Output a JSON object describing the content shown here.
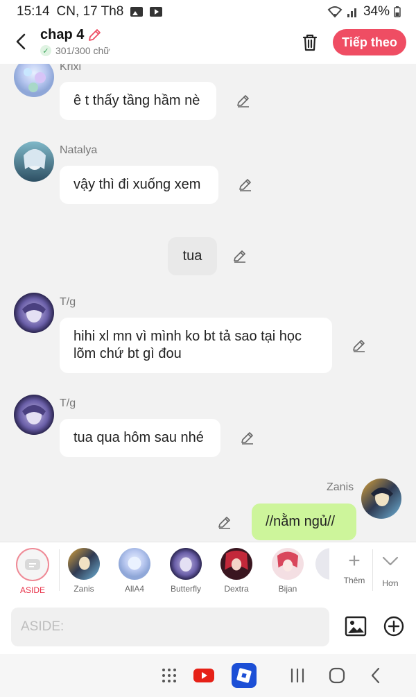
{
  "status_bar": {
    "time": "15:14",
    "date": "CN, 17 Th8",
    "battery": "34%"
  },
  "header": {
    "title": "chap 4",
    "word_count": "301/300 chữ",
    "next_label": "Tiếp theo"
  },
  "messages": [
    {
      "speaker": "Krixi",
      "text": "ê t thấy tầng hầm nè"
    },
    {
      "speaker": "Natalya",
      "text": "vậy thì đi xuống xem"
    },
    {
      "speaker": "",
      "text": "tua"
    },
    {
      "speaker": "T/g",
      "text_line1": "hihi xl mn vì mình ko bt tả sao tại học",
      "text_line2": "lõm chứ bt gì đou"
    },
    {
      "speaker": "T/g",
      "text": "tua qua hôm sau nhé"
    },
    {
      "speaker": "Zanis",
      "text": "//nằm ngủ//"
    }
  ],
  "characters": [
    {
      "label": "ASIDE"
    },
    {
      "label": "Zanis"
    },
    {
      "label": "AllA4"
    },
    {
      "label": "Butterfly"
    },
    {
      "label": "Dextra"
    },
    {
      "label": "Bijan"
    }
  ],
  "tools": {
    "add_label": "Thêm",
    "more_label": "Hơn"
  },
  "input": {
    "placeholder": "ASIDE:"
  },
  "colors": {
    "accent": "#ef4d63",
    "own_bubble": "#cdf59b",
    "aside_bubble": "#e9e9e9"
  }
}
